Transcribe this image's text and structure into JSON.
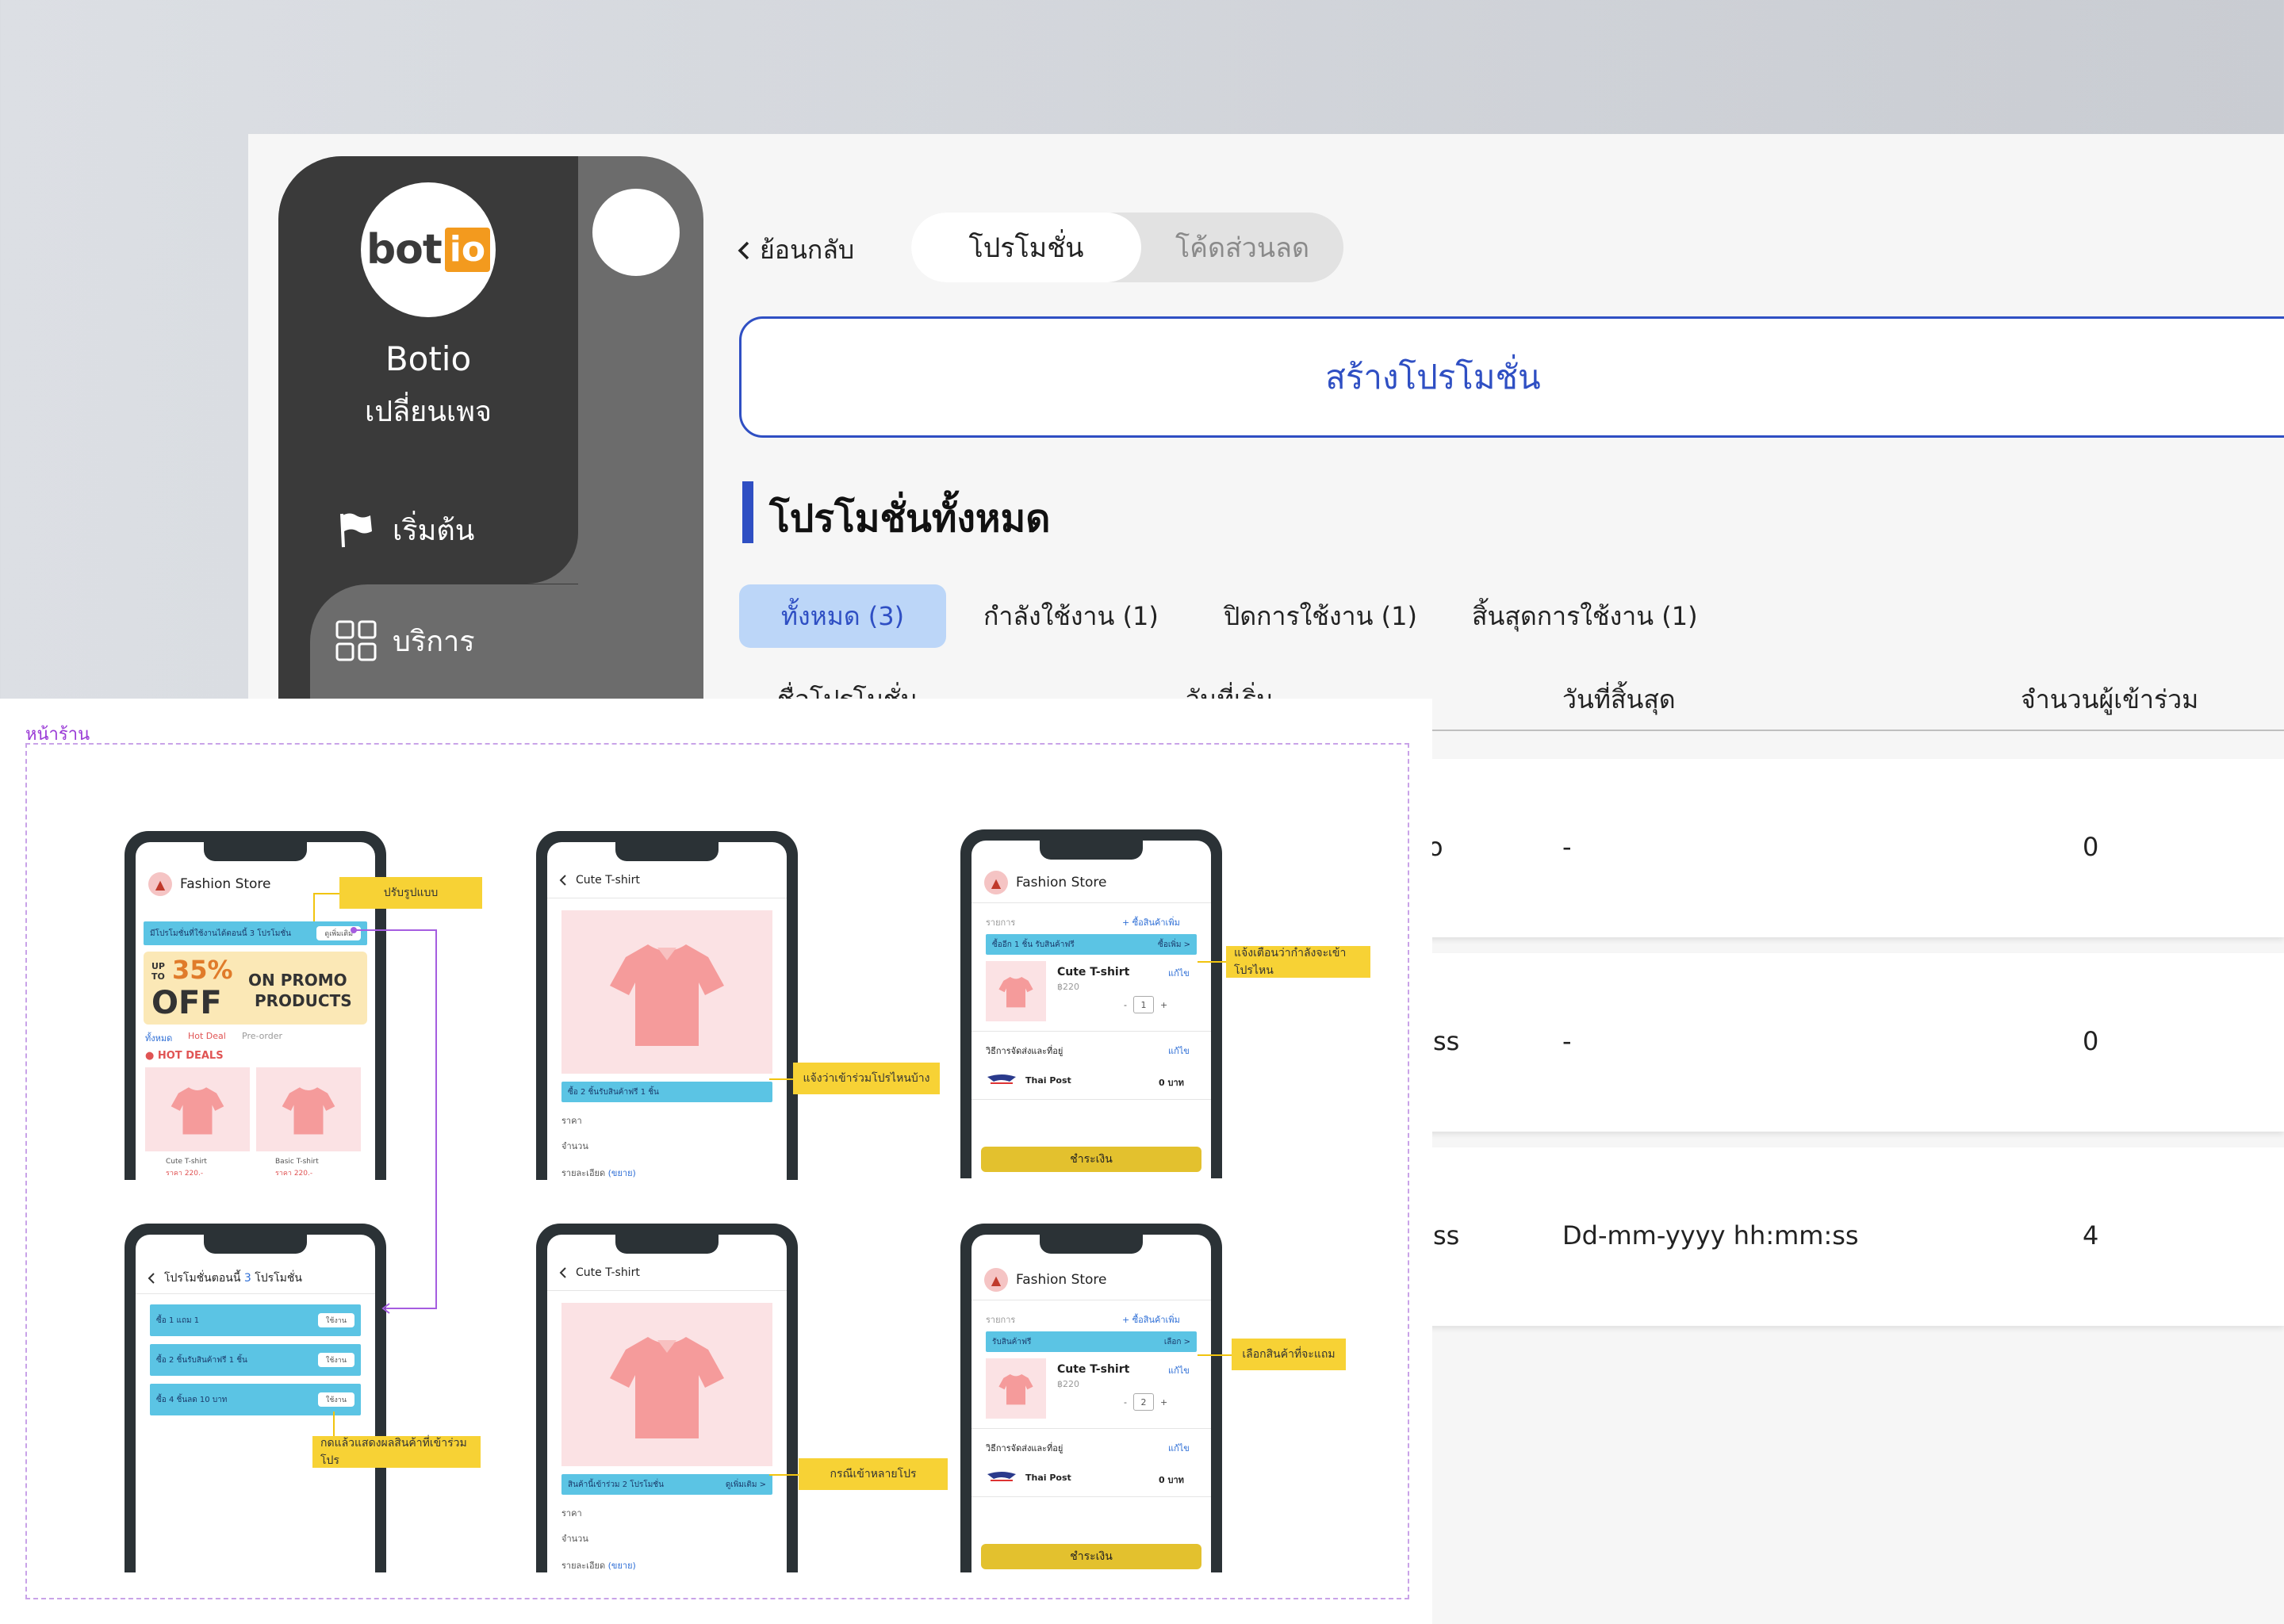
{
  "sidebar": {
    "logo": {
      "bot": "bot",
      "io": "io"
    },
    "brand": "Botio",
    "switch_page": "เปลี่ยนเพจ",
    "items": [
      {
        "label": "เริ่มต้น",
        "icon": "flag-icon"
      },
      {
        "label": "บริการ",
        "icon": "grid-icon"
      }
    ]
  },
  "header": {
    "back_label": "ย้อนกลับ",
    "tabs": [
      {
        "label": "โปรโมชั่น",
        "active": true
      },
      {
        "label": "โค้ดส่วนลด",
        "active": false
      }
    ]
  },
  "create_button": "สร้างโปรโมชั่น",
  "section_title": "โปรโมชั่นทั้งหมด",
  "filters": [
    "ทั้งหมด (3)",
    "กำลังใช้งาน (1)",
    "ปิดการใช้งาน (1)",
    "สิ้นสุดการใช้งาน (1)"
  ],
  "table": {
    "headers": [
      "ชื่อโปรโมชั่น",
      "วันที่เริ่ม",
      "วันที่สิ้นสุด",
      "จำนวนผู้เข้าร่วม"
    ],
    "rows": [
      {
        "start_tail": "o",
        "end": "-",
        "count": "0"
      },
      {
        "start_tail": "ss",
        "end": "-",
        "count": "0"
      },
      {
        "start_tail": "ss",
        "end": "Dd-mm-yyyy hh:mm:ss",
        "count": "4"
      }
    ]
  },
  "flow": {
    "label": "หน้าร้าน",
    "store_name": "Fashion Store",
    "product_name": "Cute T-shirt",
    "screen1": {
      "banner_text": "มีโปรโมชั่นที่ใช้งานได้ตอนนี้ 3 โปรโมชั่น",
      "banner_btn": "ดูเพิ่มเติม",
      "promo_up": "UP",
      "promo_to": "TO",
      "promo_pct": "35%",
      "promo_off": "OFF",
      "promo_on": "ON PROMO",
      "promo_products": "PRODUCTS",
      "tabs": [
        "ทั้งหมด",
        "Hot Deal",
        "Pre-order"
      ],
      "hot_deals": "HOT DEALS",
      "products": [
        {
          "name": "Cute T-shirt",
          "price": "ราคา 220.-"
        },
        {
          "name": "Basic T-shirt",
          "price": "ราคา 220.-"
        }
      ]
    },
    "screen2": {
      "promo_bar": "ซื้อ 2 ชิ้นรับสินค้าฟรี 1 ชิ้น",
      "price_label": "ราคา",
      "qty_label": "จำนวน",
      "detail_label": "รายละเอียด",
      "expand": "(ขยาย)"
    },
    "screen3": {
      "items_label": "รายการ",
      "add_more": "+ ซื้อสินค้าเพิ่ม",
      "promo_bar": "ซื้ออีก 1 ชิ้น รับสินค้าฟรี",
      "promo_btn": "ซื้อเพิ่ม >",
      "price": "฿220",
      "edit": "แก้ไข",
      "qty": "1",
      "shipping_label": "วิธีการจัดส่งและที่อยู่",
      "carrier": "Thai Post",
      "ship_cost": "0 บาท",
      "pay": "ชำระเงิน"
    },
    "screen4": {
      "title_pre": "โปรโมชั่นตอนนี้",
      "title_num": "3",
      "title_post": "โปรโมชั่น",
      "promos": [
        "ซื้อ 1 แถม 1",
        "ซื้อ 2 ชิ้นรับสินค้าฟรี 1 ชิ้น",
        "ซื้อ 4 ชิ้นลด 10 บาท"
      ],
      "use_btn": "ใช้งาน"
    },
    "screen5": {
      "promo_bar": "สินค้านี้เข้าร่วม 2 โปรโมชั่น",
      "promo_btn": "ดูเพิ่มเติม >"
    },
    "screen6": {
      "promo_bar": "รับสินค้าฟรี",
      "promo_btn": "เลือก >",
      "qty": "2"
    },
    "callouts": [
      "ปรับรูปแบบ",
      "แจ้งว่าเข้าร่วมโปรไหนบ้าง",
      "แจ้งเตือนว่ากำลังจะเข้าโปรไหน",
      "กดแล้วแสดงผลสินค้าที่เข้าร่วมโปร",
      "กรณีเข้าหลายโปร",
      "เลือกสินค้าที่จะแถม"
    ]
  },
  "colors": {
    "primary": "#2f4fc3",
    "sidebar_dark": "#3a3a3a",
    "sidebar_mid": "#6c6c6c",
    "filter_active_bg": "#bcd6f8",
    "callout": "#f7d235",
    "promo_bar": "#5bc4e4",
    "pay_button": "#e3c12e",
    "flow_label": "#9a3bd6"
  }
}
